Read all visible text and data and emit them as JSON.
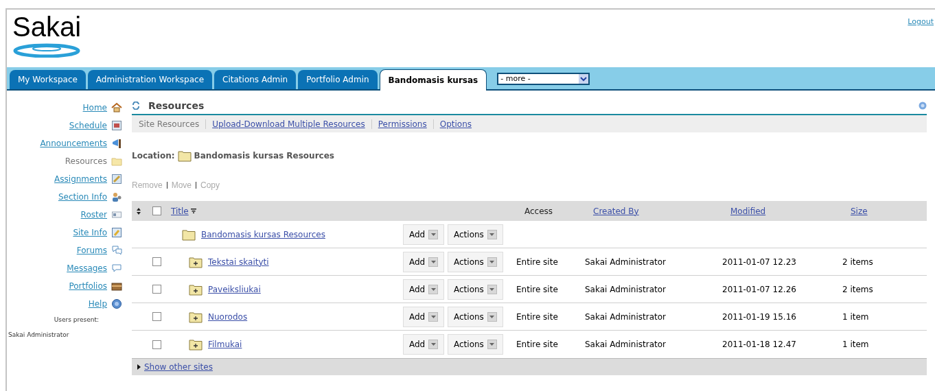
{
  "logo": {
    "text": "Sakai"
  },
  "logout": "Logout",
  "tabs": [
    {
      "label": "My Workspace",
      "selected": false
    },
    {
      "label": "Administration Workspace",
      "selected": false
    },
    {
      "label": "Citations Admin",
      "selected": false
    },
    {
      "label": "Portfolio Admin",
      "selected": false
    },
    {
      "label": "Bandomasis kursas",
      "selected": true
    }
  ],
  "more_select": {
    "value": "- more -"
  },
  "sidebar": {
    "items": [
      {
        "label": "Home",
        "selected": false
      },
      {
        "label": "Schedule",
        "selected": false
      },
      {
        "label": "Announcements",
        "selected": false
      },
      {
        "label": "Resources",
        "selected": true
      },
      {
        "label": "Assignments",
        "selected": false
      },
      {
        "label": "Section Info",
        "selected": false
      },
      {
        "label": "Roster",
        "selected": false
      },
      {
        "label": "Site Info",
        "selected": false
      },
      {
        "label": "Forums",
        "selected": false
      },
      {
        "label": "Messages",
        "selected": false
      },
      {
        "label": "Portfolios",
        "selected": false
      },
      {
        "label": "Help",
        "selected": false
      }
    ],
    "users_present_label": "Users present:",
    "users": [
      "Sakai Administrator"
    ]
  },
  "tool": {
    "title": "Resources",
    "nav": [
      {
        "label": "Site Resources",
        "selected": true
      },
      {
        "label": "Upload-Download Multiple Resources",
        "selected": false
      },
      {
        "label": "Permissions",
        "selected": false
      },
      {
        "label": "Options",
        "selected": false
      }
    ],
    "location_label": "Location:",
    "location": "Bandomasis kursas Resources",
    "bulk_actions": [
      {
        "label": "Remove",
        "disabled": true
      },
      {
        "label": "Move",
        "disabled": true
      },
      {
        "label": "Copy",
        "disabled": true
      }
    ],
    "table": {
      "select_all_checked": false,
      "columns": [
        "Title",
        "Access",
        "Created By",
        "Modified",
        "Size"
      ],
      "rows": [
        {
          "kind": "root",
          "title": "Bandomasis kursas Resources",
          "add": "Add",
          "actions": "Actions"
        },
        {
          "kind": "folder",
          "checked": false,
          "title": "Tekstai skaityti",
          "add": "Add",
          "actions": "Actions",
          "access": "Entire site",
          "created_by": "Sakai Administrator",
          "modified": "2011-01-07 12.23",
          "size": "2 items"
        },
        {
          "kind": "folder",
          "checked": false,
          "title": "Paveiksliukai",
          "add": "Add",
          "actions": "Actions",
          "access": "Entire site",
          "created_by": "Sakai Administrator",
          "modified": "2011-01-07 12.26",
          "size": "2 items"
        },
        {
          "kind": "folder",
          "checked": false,
          "title": "Nuorodos",
          "add": "Add",
          "actions": "Actions",
          "access": "Entire site",
          "created_by": "Sakai Administrator",
          "modified": "2011-01-19 15.16",
          "size": "1 item"
        },
        {
          "kind": "folder",
          "checked": false,
          "title": "Filmukai",
          "add": "Add",
          "actions": "Actions",
          "access": "Entire site",
          "created_by": "Sakai Administrator",
          "modified": "2011-01-18 12.47",
          "size": "1 item"
        }
      ],
      "footer_link": "Show other sites"
    }
  }
}
